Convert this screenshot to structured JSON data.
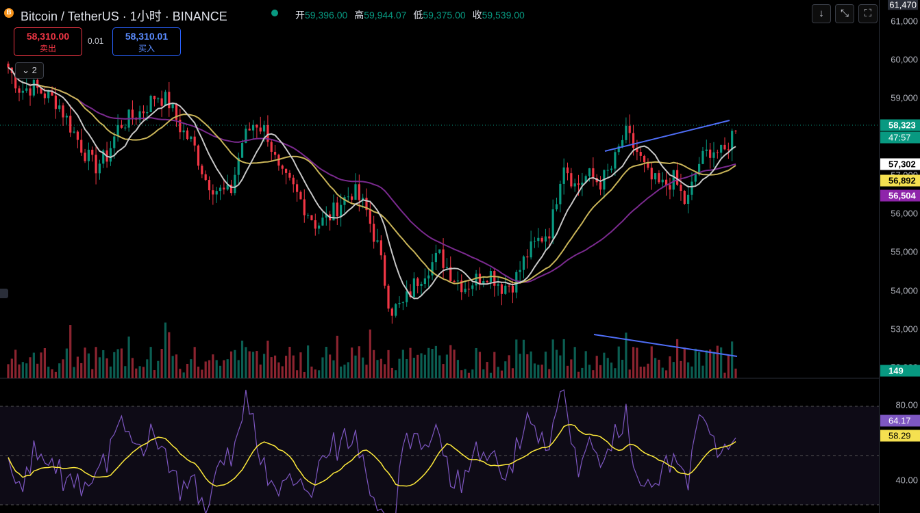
{
  "header": {
    "title": "Bitcoin / TetherUS · 1小时 · BINANCE",
    "open_label": "开",
    "open": "59,396.00",
    "high_label": "高",
    "high": "59,944.07",
    "low_label": "低",
    "low": "59,375.00",
    "close_label": "收",
    "close": "59,539.00",
    "symbol_badge": "B"
  },
  "trade": {
    "sell_price": "58,310.00",
    "sell_label": "卖出",
    "spread": "0.01",
    "buy_price": "58,310.01",
    "buy_label": "买入"
  },
  "legend_toggle": "2",
  "toolbar": {
    "down_icon": "arrow-down-icon",
    "expand_icon": "expand-icon",
    "fullscreen_icon": "fullscreen-icon"
  },
  "price_axis": {
    "top_label": "61,470",
    "ticks": [
      "61,000",
      "60,000",
      "59,000",
      "58,000",
      "57,000",
      "56,000",
      "55,000",
      "54,000",
      "53,000",
      "52,000"
    ],
    "tick_values": [
      61000,
      60000,
      59000,
      58000,
      57000,
      56000,
      55000,
      54000,
      53000,
      52000
    ]
  },
  "rsi_axis": {
    "ticks": [
      "80.00",
      "40.00"
    ],
    "tick_values": [
      80,
      40
    ]
  },
  "tags": {
    "last_price": "58,323",
    "countdown": "47:57",
    "ma_white": "57,302",
    "ma_yellow": "56,892",
    "ma_purple": "56,504",
    "volume": "149",
    "rsi": "64.17",
    "rsi_ma": "58.29"
  },
  "colors": {
    "up": "#089981",
    "down": "#f23645",
    "ma_white": "#c8c8c8",
    "ma_yellow": "#c9b458",
    "ma_purple": "#7b2a8f",
    "trendline": "#4f6ef7",
    "rsi": "#7e57c2",
    "rsi_ma": "#ffeb3b"
  },
  "chart_data": {
    "type": "candlestick",
    "symbol": "Bitcoin / TetherUS",
    "interval": "1小时",
    "exchange": "BINANCE",
    "price_path": [
      59800,
      59200,
      59300,
      59100,
      58900,
      58300,
      57700,
      57200,
      57500,
      58300,
      58500,
      58700,
      59100,
      58900,
      58200,
      57800,
      56900,
      56600,
      56500,
      57900,
      58400,
      58100,
      57000,
      56700,
      56200,
      55700,
      55900,
      56300,
      56600,
      56100,
      55100,
      53500,
      53600,
      54200,
      54600,
      54900,
      54400,
      54100,
      54300,
      54500,
      54100,
      54200,
      54900,
      55300,
      55600,
      57400,
      56700,
      57000,
      56800,
      57200,
      58100,
      57600,
      56900,
      56700,
      56900,
      56200,
      57300,
      57700,
      57500,
      58300
    ],
    "series": [
      {
        "name": "MA",
        "last": 57302
      },
      {
        "name": "MA",
        "last": 56892
      },
      {
        "name": "MA",
        "last": 56504
      }
    ],
    "volume_last": 149,
    "rsi_last": 64.17,
    "rsi_ma_last": 58.29
  }
}
